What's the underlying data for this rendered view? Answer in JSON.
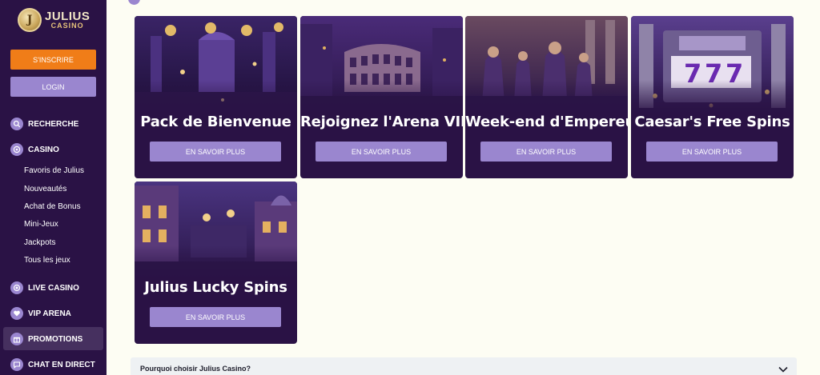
{
  "logo": {
    "brand": "JULIUS",
    "sub": "CASINO"
  },
  "auth": {
    "signup_label": "S'INSCRIRE",
    "login_label": "LOGIN"
  },
  "sidebar": {
    "search_label": "RECHERCHE",
    "casino_label": "CASINO",
    "casino_sub": [
      "Favoris de Julius",
      "Nouveautés",
      "Achat de Bonus",
      "Mini-Jeux",
      "Jackpots",
      "Tous les jeux"
    ],
    "live_casino_label": "LIVE CASINO",
    "vip_arena_label": "VIP ARENA",
    "promotions_label": "PROMOTIONS",
    "chat_label": "CHAT EN DIRECT"
  },
  "promotions": [
    {
      "title": "Pack de Bienvenue",
      "button": "EN SAVOIR PLUS"
    },
    {
      "title": "Rejoignez l'Arena VIP",
      "button": "EN SAVOIR PLUS"
    },
    {
      "title": "Week-end d'Empereur",
      "button": "EN SAVOIR PLUS"
    },
    {
      "title": "Caesar's Free Spins",
      "button": "EN SAVOIR PLUS"
    },
    {
      "title": "Julius Lucky Spins",
      "button": "EN SAVOIR PLUS"
    }
  ],
  "faq": {
    "question": "Pourquoi choisir Julius Casino?"
  },
  "icons": {
    "search": "search-icon",
    "casino": "chip-icon",
    "live_casino": "live-icon",
    "vip": "heart-icon",
    "promotions": "gift-icon",
    "chat": "chat-icon",
    "faq_toggle": "chevron-down-icon"
  },
  "colors": {
    "sidebar_bg": "#2a1245",
    "signup": "#f07d18",
    "accent": "#9a86cf",
    "page_bg": "#fdfdf3",
    "card_bg": "#2a1245",
    "faq_bg": "#eef1f3"
  }
}
